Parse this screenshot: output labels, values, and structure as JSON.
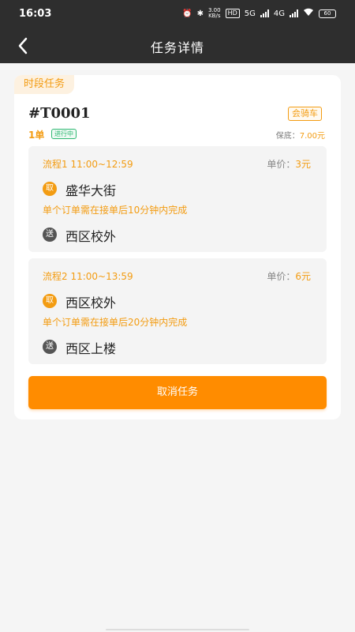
{
  "status_bar": {
    "time": "16:03",
    "net_speed_top": "3.00",
    "net_speed_bottom": "KB/s",
    "hd_label": "HD",
    "signal_5g": "5G",
    "signal_4g": "4G",
    "battery": "60"
  },
  "nav": {
    "title": "任务详情"
  },
  "task": {
    "period_tag": "时段任务",
    "id": "#T0001",
    "carpool_tag": "会骑车",
    "orders": "1单",
    "status": "进行中",
    "guarantee_label": "保底：",
    "guarantee_amount": "7.00元"
  },
  "steps": [
    {
      "head": "流程1  11:00~12:59",
      "price_label": "单价：",
      "price_value": "3元",
      "pick_icon": "取",
      "pick": "盛华大街",
      "note": "单个订单需在接单后10分钟内完成",
      "drop_icon": "送",
      "drop": "西区校外"
    },
    {
      "head": "流程2  11:00~13:59",
      "price_label": "单价：",
      "price_value": "6元",
      "pick_icon": "取",
      "pick": "西区校外",
      "note": "单个订单需在接单后20分钟内完成",
      "drop_icon": "送",
      "drop": "西区上楼"
    }
  ],
  "actions": {
    "cancel": "取消任务"
  },
  "colors": {
    "accent": "#ff8c00",
    "header_bg": "#2e2e2e",
    "status_green": "#2eb872"
  }
}
